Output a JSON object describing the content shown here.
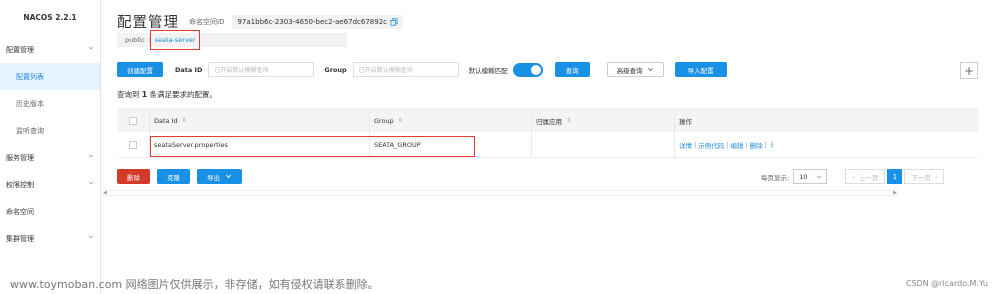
{
  "app": {
    "name": "NACOS 2.2.1"
  },
  "sidebar": {
    "items": [
      {
        "label": "配置管理",
        "expandable": true,
        "icon": "chevron-down-icon"
      },
      {
        "label": "配置列表",
        "sub": true,
        "active": true
      },
      {
        "label": "历史版本",
        "sub": true
      },
      {
        "label": "监听查询",
        "sub": true
      },
      {
        "label": "服务管理",
        "expandable": true,
        "icon": "chevron-down-icon"
      },
      {
        "label": "权限控制",
        "expandable": true,
        "icon": "chevron-down-icon"
      },
      {
        "label": "命名空间"
      },
      {
        "label": "集群管理",
        "expandable": true,
        "icon": "chevron-down-icon"
      }
    ]
  },
  "header": {
    "title": "配置管理",
    "namespace_label": "命名空间ID",
    "namespace_id": "97a1bb6c-2303-4650-bec2-ae67dc67892c",
    "copy_icon": "copy-icon"
  },
  "breadcrumb": {
    "public": "public",
    "separator": "|",
    "current": "seata-server"
  },
  "toolbar": {
    "create_button": "创建配置",
    "dataid_label": "Data ID",
    "dataid_placeholder": "已开启默认模糊查询",
    "group_label": "Group",
    "group_placeholder": "已开启默认模糊查询",
    "fuzzy_label": "默认模糊匹配",
    "fuzzy_on": true,
    "query_button": "查询",
    "advanced_button": "高级查询",
    "import_button": "导入配置",
    "add_icon": "+"
  },
  "result": {
    "prefix": "查询到",
    "count": "1",
    "suffix": "条满足要求的配置。"
  },
  "table": {
    "columns": [
      "Data Id",
      "Group",
      "归属应用",
      "操作"
    ],
    "sort_icon": "⇕",
    "rows": [
      {
        "data_id": "seataServer.properties",
        "group": "SEATA_GROUP",
        "app": "",
        "ops": [
          "详情",
          "示例代码",
          "编辑",
          "删除"
        ],
        "more": "⋮"
      }
    ]
  },
  "bottom": {
    "delete_button": "删除",
    "clone_button": "克隆",
    "export_button": "导出"
  },
  "pager": {
    "page_size_label": "每页显示:",
    "page_size": "10",
    "prev": "上一页",
    "current_page": "1",
    "next": "下一页"
  },
  "colors": {
    "primary": "#1890e6",
    "danger": "#d23a2a",
    "highlight_box": "#e53935"
  },
  "watermark": "www.toymoban.com 网络图片仅供展示，非存储，如有侵权请联系删除。",
  "credit": "CSDN @ricardo.M.Yu"
}
